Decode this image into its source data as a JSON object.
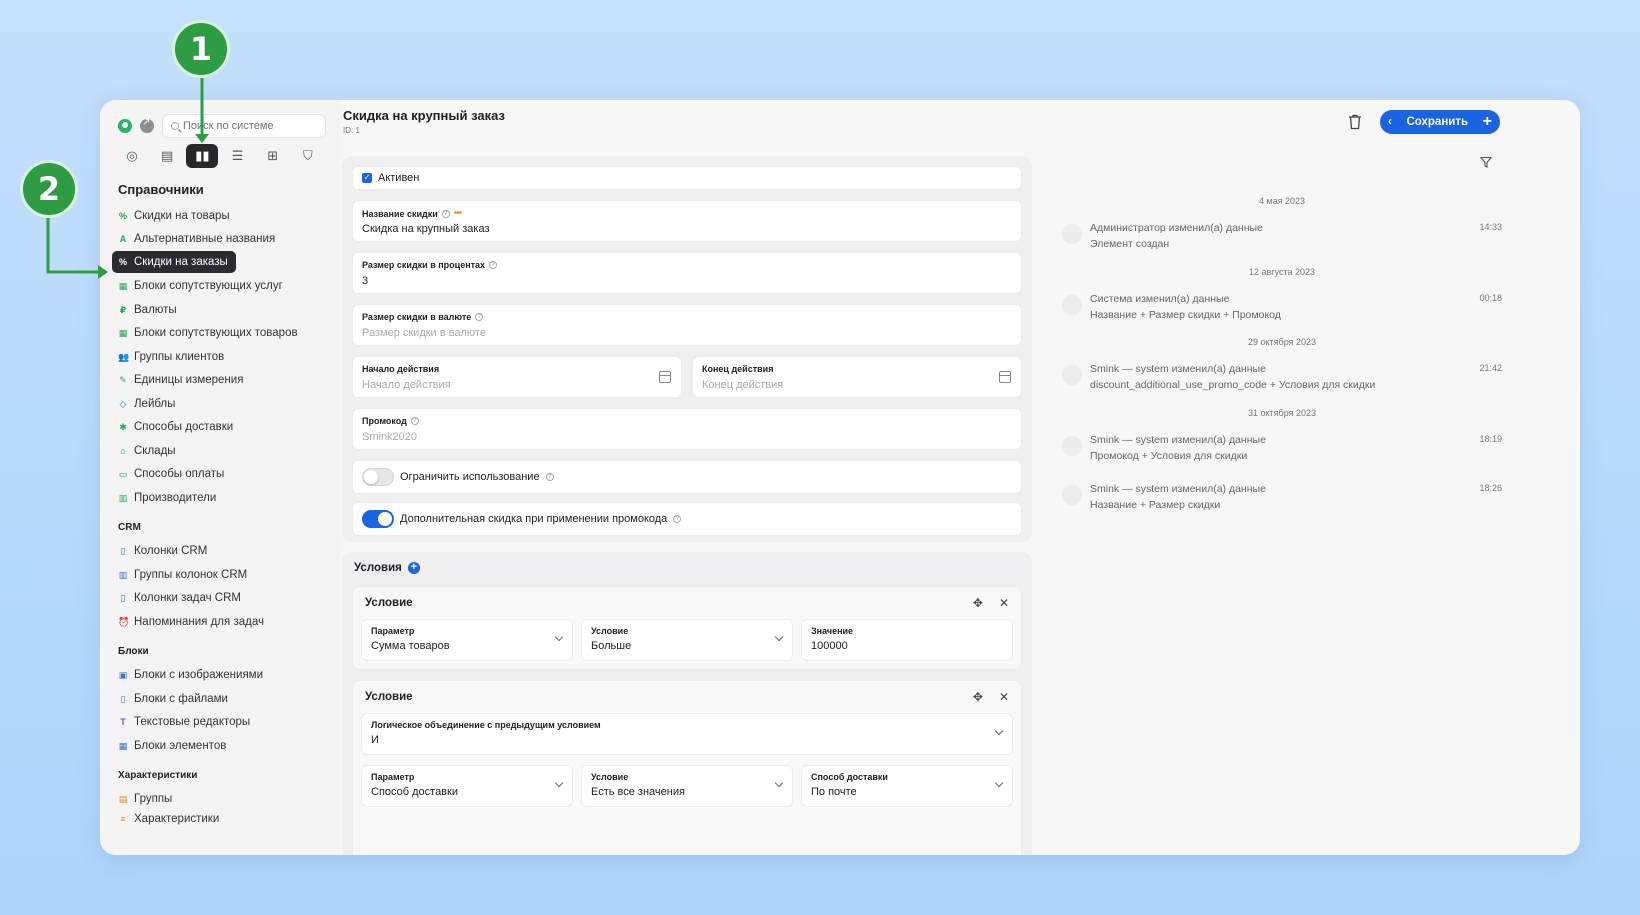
{
  "annotations": {
    "badge1": "1",
    "badge2": "2"
  },
  "sidebar": {
    "search_placeholder": "Поиск по системе",
    "heading": "Справочники",
    "items": [
      {
        "label": "Скидки на товары",
        "icon": "%"
      },
      {
        "label": "Альтернативные названия",
        "icon": "A"
      },
      {
        "label": "Скидки на заказы",
        "icon": "%"
      },
      {
        "label": "Блоки сопутствующих услуг",
        "icon": "▦"
      },
      {
        "label": "Валюты",
        "icon": "₽"
      },
      {
        "label": "Блоки сопутствующих товаров",
        "icon": "▦"
      },
      {
        "label": "Группы клиентов",
        "icon": "👥"
      },
      {
        "label": "Единицы измерения",
        "icon": "✎"
      },
      {
        "label": "Лейблы",
        "icon": "◇"
      },
      {
        "label": "Способы доставки",
        "icon": "✱"
      },
      {
        "label": "Склады",
        "icon": "⌂"
      },
      {
        "label": "Способы оплаты",
        "icon": "▭"
      },
      {
        "label": "Производители",
        "icon": "▥"
      }
    ],
    "crm_heading": "CRM",
    "crm_items": [
      {
        "label": "Колонки CRM"
      },
      {
        "label": "Группы колонок CRM"
      },
      {
        "label": "Колонки задач CRM"
      },
      {
        "label": "Напоминания для задач"
      }
    ],
    "blocks_heading": "Блоки",
    "blocks_items": [
      {
        "label": "Блоки с изображениями"
      },
      {
        "label": "Блоки с файлами"
      },
      {
        "label": "Текстовые редакторы"
      },
      {
        "label": "Блоки элементов"
      }
    ],
    "chars_heading": "Характеристики",
    "chars_items": [
      {
        "label": "Группы"
      },
      {
        "label": "Характеристики"
      }
    ]
  },
  "header": {
    "title": "Скидка на крупный заказ",
    "id": "ID: 1",
    "save_label": "Сохранить"
  },
  "form": {
    "active_label": "Активен",
    "name_label": "Название скидки",
    "name_value": "Скидка на крупный заказ",
    "percent_label": "Размер скидки в процентах",
    "percent_value": "3",
    "currency_label": "Размер скидки в валюте",
    "currency_placeholder": "Размер скидки в валюте",
    "start_label": "Начало действия",
    "start_placeholder": "Начало действия",
    "end_label": "Конец действия",
    "end_placeholder": "Конец действия",
    "promo_label": "Промокод",
    "promo_placeholder": "Smink2020",
    "limit_label": "Ограничить использование",
    "extra_label": "Дополнительная скидка при применении промокода"
  },
  "conditions": {
    "title": "Условия",
    "cards": [
      {
        "title": "Условие",
        "param_label": "Параметр",
        "param_value": "Сумма товаров",
        "cond_label": "Условие",
        "cond_value": "Больше",
        "value_label": "Значение",
        "value_value": "100000"
      },
      {
        "title": "Условие",
        "logic_label": "Логическое объединение с предыдущим условием",
        "logic_value": "И",
        "param_label": "Параметр",
        "param_value": "Способ доставки",
        "cond_label": "Условие",
        "cond_value": "Есть все значения",
        "delivery_label": "Способ доставки",
        "delivery_value": "По почте"
      }
    ]
  },
  "history": {
    "groups": [
      {
        "date": "4 мая 2023",
        "entries": [
          {
            "line1": "Администратор изменил(а) данные",
            "line2": "Элемент создан",
            "time": "14:33"
          }
        ]
      },
      {
        "date": "12 августа 2023",
        "entries": [
          {
            "line1": "Система изменил(а) данные",
            "line2": "Название + Размер скидки + Промокод",
            "time": "00:18"
          }
        ]
      },
      {
        "date": "29 октября 2023",
        "entries": [
          {
            "line1": "Smink — system изменил(а) данные",
            "line2": "discount_additional_use_promo_code + Условия для скидки",
            "time": "21:42"
          }
        ]
      },
      {
        "date": "31 октября 2023",
        "entries": [
          {
            "line1": "Smink — system изменил(а) данные",
            "line2": "Промокод + Условия для скидки",
            "time": "18:19"
          },
          {
            "line1": "Smink — system изменил(а) данные",
            "line2": "Название + Размер скидки",
            "time": "18:26"
          }
        ]
      }
    ]
  },
  "colors": {
    "accent": "#1a63e3",
    "badge": "#2e9c44",
    "active_nav": "#2b2b31"
  }
}
